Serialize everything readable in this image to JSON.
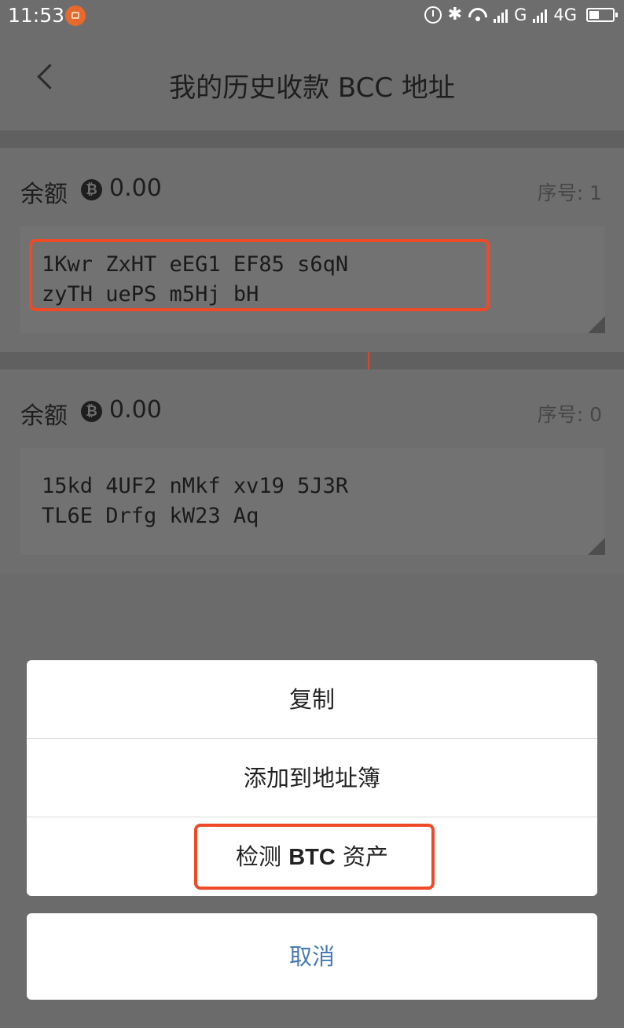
{
  "status_bar": {
    "time": "11:53",
    "network_label_1": "G",
    "network_label_2": "4G",
    "icons": [
      "notification-app-icon",
      "alarm-icon",
      "bluetooth-icon",
      "wifi-icon",
      "signal-icon",
      "signal-icon",
      "battery-icon"
    ]
  },
  "header": {
    "title": "我的历史收款 BCC 地址",
    "back_icon": "chevron-left-icon"
  },
  "addresses": [
    {
      "balance_label": "余额",
      "coin_symbol": "₿",
      "balance": "0.00",
      "seq": "序号: 1",
      "address": "1Kwr ZxHT eEG1 EF85 s6qN\nzyTH uePS m5Hj bH"
    },
    {
      "balance_label": "余额",
      "coin_symbol": "₿",
      "balance": "0.00",
      "seq": "序号: 0",
      "address": "15kd 4UF2 nMkf xv19 5J3R\nTL6E Drfg kW23 Aq"
    }
  ],
  "action_sheet": {
    "items": [
      {
        "label": "复制"
      },
      {
        "label": "添加到地址簿"
      },
      {
        "label_prefix": "检测 ",
        "label_bold": "BTC",
        "label_suffix": " 资产"
      }
    ],
    "cancel": "取消"
  },
  "colors": {
    "highlight": "#ef4a28",
    "cancel_text": "#4a7ab5",
    "overlay": "#6b6b6b"
  }
}
